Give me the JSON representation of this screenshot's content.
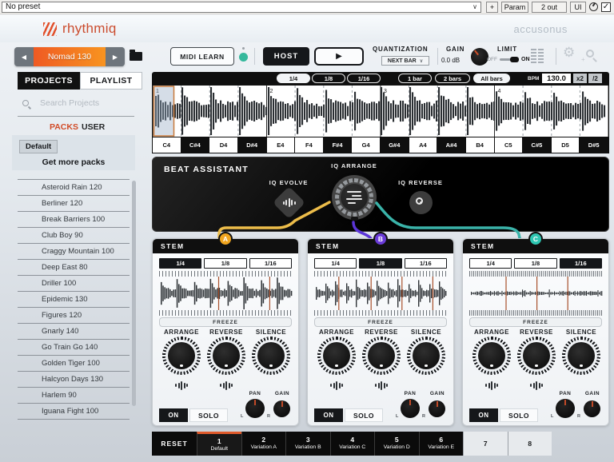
{
  "icons": {
    "gear": "⚙",
    "play": "▶",
    "prev": "◀",
    "next": "▶",
    "check": "✓",
    "chevron": "∨"
  },
  "colors": {
    "accent": "#e05a2b",
    "stem_a": "#f0a51f",
    "stem_b": "#6a3bd8",
    "stem_c": "#2ec6b2",
    "cable_a": "#edbd4a",
    "cable_b": "#5b35d8",
    "cable_c": "#3ab3a9"
  },
  "host_bar": {
    "preset": "No preset",
    "add": "+",
    "param": "Param",
    "out": "2 out",
    "ui": "UI"
  },
  "header": {
    "logo": "rhythmiq",
    "brand": "accusonus"
  },
  "toolbar": {
    "preset_name": "Nomad 130",
    "midi_learn": "MIDI LEARN",
    "host": "HOST",
    "quantization_label": "QUANTIZATION",
    "quantization_value": "NEXT BAR",
    "gain_label": "GAIN",
    "gain_value": "0.0 dB",
    "limit_label": "LIMIT",
    "limit_off": "OFF",
    "limit_on": "ON"
  },
  "sidebar": {
    "tab_projects": "PROJECTS",
    "tab_playlist": "PLAYLIST",
    "search_placeholder": "Search Projects",
    "packs_label": "PACKS",
    "user_label": "USER",
    "default_chip": "Default",
    "get_more": "Get more packs",
    "packs": [
      "Asteroid Rain 120",
      "Berliner 120",
      "Break Barriers 100",
      "Club Boy 90",
      "Craggy Mountain 100",
      "Deep East 80",
      "Driller 100",
      "Epidemic 130",
      "Figures 120",
      "Gnarly 140",
      "Go Train Go 140",
      "Golden Tiger 100",
      "Halcyon Days 130",
      "Harlem 90",
      "Iguana Fight 100"
    ]
  },
  "transport": {
    "div_14": "1/4",
    "div_18": "1/8",
    "div_116": "1/16",
    "bar_1": "1 bar",
    "bar_2": "2 bars",
    "bar_all": "All bars",
    "bpm_label": "BPM",
    "bpm_value": "130.0",
    "mul": "x2",
    "half": "/2",
    "bar_numbers": [
      "1",
      "2",
      "3",
      "4"
    ],
    "notes": [
      {
        "label": "C4",
        "cls": "white"
      },
      {
        "label": "C#4",
        "cls": "black"
      },
      {
        "label": "D4",
        "cls": "white"
      },
      {
        "label": "D#4",
        "cls": "black"
      },
      {
        "label": "E4",
        "cls": "white"
      },
      {
        "label": "F4",
        "cls": "white"
      },
      {
        "label": "F#4",
        "cls": "black"
      },
      {
        "label": "G4",
        "cls": "white"
      },
      {
        "label": "G#4",
        "cls": "black"
      },
      {
        "label": "A4",
        "cls": "white"
      },
      {
        "label": "A#4",
        "cls": "black"
      },
      {
        "label": "B4",
        "cls": "white"
      },
      {
        "label": "C5",
        "cls": "white"
      },
      {
        "label": "C#5",
        "cls": "black"
      },
      {
        "label": "D5",
        "cls": "white"
      },
      {
        "label": "D#5",
        "cls": "black"
      }
    ]
  },
  "beat_assistant": {
    "title": "BEAT ASSISTANT",
    "evolve": "IQ EVOLVE",
    "arrange": "IQ ARRANGE",
    "reverse": "IQ REVERSE"
  },
  "stems": [
    {
      "title": "STEM",
      "tag": "A",
      "color": "#f0a51f",
      "d1": "1/4",
      "d2": "1/8",
      "d3": "1/16",
      "active": 0,
      "freeze": "FREEZE",
      "arrange": "ARRANGE",
      "reverse": "REVERSE",
      "silence": "SILENCE",
      "on": "ON",
      "solo": "SOLO",
      "pan": "PAN",
      "gain": "GAIN",
      "left": "L",
      "right": "R"
    },
    {
      "title": "STEM",
      "tag": "B",
      "color": "#6a3bd8",
      "d1": "1/4",
      "d2": "1/8",
      "d3": "1/16",
      "active": 1,
      "freeze": "FREEZE",
      "arrange": "ARRANGE",
      "reverse": "REVERSE",
      "silence": "SILENCE",
      "on": "ON",
      "solo": "SOLO",
      "pan": "PAN",
      "gain": "GAIN",
      "left": "L",
      "right": "R"
    },
    {
      "title": "STEM",
      "tag": "C",
      "color": "#2ec6b2",
      "d1": "1/4",
      "d2": "1/8",
      "d3": "1/16",
      "active": 2,
      "freeze": "FREEZE",
      "arrange": "ARRANGE",
      "reverse": "REVERSE",
      "silence": "SILENCE",
      "on": "ON",
      "solo": "SOLO",
      "pan": "PAN",
      "gain": "GAIN",
      "left": "L",
      "right": "R"
    }
  ],
  "pattern_bar": {
    "reset": "RESET",
    "slots": [
      {
        "num": "1",
        "name": "Default",
        "cls": "active"
      },
      {
        "num": "2",
        "name": "Variation A",
        "cls": "filled"
      },
      {
        "num": "3",
        "name": "Variation B",
        "cls": "filled"
      },
      {
        "num": "4",
        "name": "Variation C",
        "cls": "filled"
      },
      {
        "num": "5",
        "name": "Variation D",
        "cls": "filled"
      },
      {
        "num": "6",
        "name": "Variation E",
        "cls": "filled"
      },
      {
        "num": "7",
        "name": "",
        "cls": "empty"
      },
      {
        "num": "8",
        "name": "",
        "cls": "empty"
      }
    ]
  }
}
